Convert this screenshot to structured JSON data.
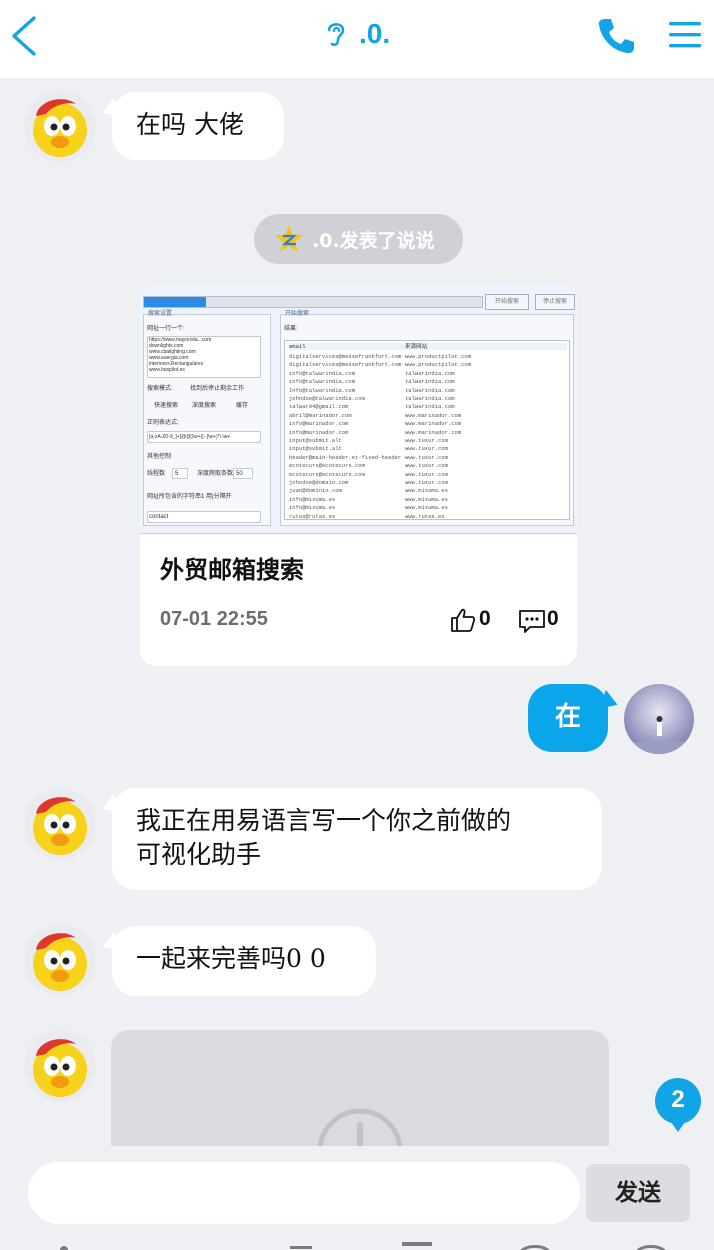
{
  "header": {
    "title": ".0.",
    "icons": {
      "back": "back-chevron-icon",
      "ear": "ear-icon",
      "phone": "phone-icon",
      "menu": "menu-icon"
    },
    "accent_color": "#12a5e6"
  },
  "messages": [
    {
      "from": "other",
      "text": "在吗 大佬"
    },
    {
      "type": "notice",
      "text": ".0.发表了说说",
      "icon": "qzone-star-icon"
    },
    {
      "from": "other",
      "type": "card",
      "title": "外贸邮箱搜索",
      "time": "07-01 22:55",
      "likes": "0",
      "comments": "0",
      "thumb": {
        "btn_start": "开始搜索",
        "btn_stop": "停止搜索",
        "left_panel_title": "搜索设置",
        "right_panel_title": "开始搜索",
        "url_label": "网址一行一个:",
        "urls": [
          "https://www.mayorista...com",
          "downlights.com",
          "www.cbalighting.com",
          "www.euergia.com",
          "interiores.Rectangulares",
          "www.hospilot.es"
        ],
        "mode_label": "搜索模式:",
        "stop_after_found": "找到后停止剩余工作",
        "fast_search": "快速搜索",
        "deep_search": "深度搜索",
        "cache": "缓存",
        "regex_label": "正则表达式:",
        "regex": "[a-zA-Z0-9_]+[@@]\\w+([-.]\\w+)*\\.\\w+",
        "other_control": "其他控制",
        "threads_label": "线程数",
        "threads": "5",
        "depth_label": "深度爬取条数",
        "depth": "50",
        "url_contains_label": "网址所包含的字符串1 用|分隔开",
        "url_contains": "contact",
        "results_label": "结果:",
        "col_email": "email",
        "col_source": "来源网站",
        "rows": [
          [
            "digitalservices@messefrankfurt.com",
            "www.productpilot.com"
          ],
          [
            "digitalservices@messefrankfurt.com",
            "www.productpilot.com"
          ],
          [
            "info@talwarindia.com",
            "talwarindia.com"
          ],
          [
            "info@talwarindia.com",
            "talwarindia.com"
          ],
          [
            "Info@talwarindia.com",
            "talwarindia.com"
          ],
          [
            "johndoe@talwarindia.com",
            "talwarindia.com"
          ],
          [
            "talwar94@gmail.com",
            "talwarindia.com"
          ],
          [
            "abril@marinador.com",
            "www.marinador.com"
          ],
          [
            "info@marinador.com",
            "www.marinador.com"
          ],
          [
            "info@marinador.com",
            "www.marinador.com"
          ],
          [
            "input@submit.alt",
            "www.tuxur.com"
          ],
          [
            "input@submit.alt",
            "www.tuxur.com"
          ],
          [
            "header@main-header.et-fixed-header",
            "www.tuxur.com"
          ],
          [
            "ecotecurs@ecotecurs.com",
            "www.tuxur.com"
          ],
          [
            "ecotecurs@ecotecurs.com",
            "www.tuxur.com"
          ],
          [
            "johndoe@domain.com",
            "www.tuxur.com"
          ],
          [
            "juan@dominio.com",
            "www.mixuma.es"
          ],
          [
            "info@mixuma.es",
            "www.mixuma.es"
          ],
          [
            "info@mixuma.es",
            "www.mixuma.es"
          ],
          [
            "rutas@rutas.es",
            "www.rutas.es"
          ]
        ]
      }
    },
    {
      "from": "me",
      "text": "在"
    },
    {
      "from": "other",
      "text_lines": [
        "我正在用易语言写一个你之前做的",
        "可视化助手"
      ]
    },
    {
      "from": "other",
      "text": "一起来完善吗0 0"
    },
    {
      "from": "other",
      "type": "loading",
      "icon": "loading-clock-icon"
    }
  ],
  "unread_badge": "2",
  "input": {
    "placeholder": "",
    "value": ""
  },
  "send_label": "发送"
}
